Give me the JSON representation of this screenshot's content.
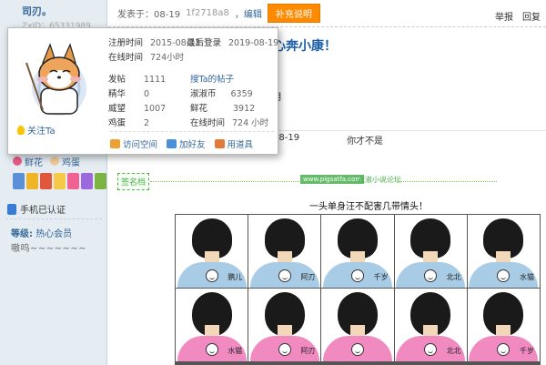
{
  "user": {
    "name": "司刃。",
    "zxid": "ZxID：65331989"
  },
  "post": {
    "published": "发表于：08-19",
    "hash": "1f2718a8",
    "edit": "，编辑",
    "add_note": "补充说明",
    "report": "举报",
    "reply": "回复"
  },
  "popup": {
    "reg_label": "注册时间",
    "reg_value": "2015-08-13",
    "last_label": "最后登录",
    "last_value": "2019-08-19",
    "online_label": "在线时间",
    "online_value": "724小时",
    "posts_label": "发帖",
    "posts_value": "1111",
    "search_posts": "搜Ta的帖子",
    "elite_label": "精华",
    "elite_value": "0",
    "coin_label": "淑淑币",
    "coin_value": "6359",
    "prestige_label": "威望",
    "prestige_value": "1007",
    "flower_label": "鲜花",
    "flower_value": "3912",
    "egg_label": "鸡蛋",
    "egg_value": "2",
    "online2_label": "在线时间",
    "online2_value": "724 小时",
    "follow": "关注Ta",
    "visit": "访问空间",
    "add_friend": "加好友",
    "use_tool": "用道具"
  },
  "title_fragment": "心奔小康！",
  "body_fragment": "月",
  "row": {
    "date": "08-19",
    "text": "你才不是"
  },
  "sidebar": {
    "flower": "鲜花",
    "egg": "鸡蛋",
    "phone": "手机已认证",
    "grade_label": "等级:",
    "grade_value": "热心会员",
    "signature": "嗷呜~~~~~~~"
  },
  "sig": {
    "tag": "签名档",
    "watermark": "www.pigsatfa.com",
    "site": "淑淑小说论坛",
    "caption": "一头单身汪不配害几带情头！"
  },
  "grid": {
    "top": [
      "鹏儿",
      "阿刃",
      "千岁",
      "北北",
      "水猫"
    ],
    "bottom": [
      "水猫",
      "阿刃",
      "",
      "北北",
      "千岁"
    ]
  },
  "colors": {
    "accent": "#336699",
    "orange": "#ff8a00",
    "title_blue": "#1c5ea8",
    "shirt_blue": "#a8cce6",
    "shirt_pink": "#f08ac1"
  }
}
